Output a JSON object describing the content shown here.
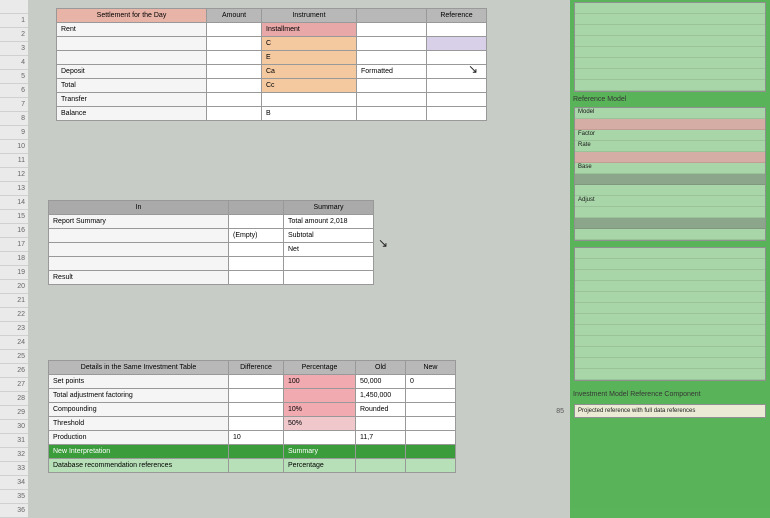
{
  "rowHeaders": [
    "",
    "1",
    "2",
    "3",
    "4",
    "5",
    "6",
    "7",
    "8",
    "9",
    "10",
    "11",
    "12",
    "13",
    "14",
    "15",
    "16",
    "17",
    "18",
    "19",
    "20",
    "21",
    "22",
    "23",
    "24",
    "25",
    "26",
    "27",
    "28",
    "29",
    "30",
    "31",
    "32",
    "33",
    "34",
    "35",
    "36"
  ],
  "t1": {
    "headers": [
      "Settlement for the Day",
      "Amount",
      "Instrument",
      "",
      "Reference"
    ],
    "rows": [
      {
        "c": [
          "Rent",
          "",
          "Installment",
          "",
          ""
        ],
        "cls3": "cell-rose"
      },
      {
        "c": [
          "",
          "",
          "C",
          "",
          ""
        ],
        "cls3": "cell-peach",
        "cls5": "cell-lav"
      },
      {
        "c": [
          "",
          "",
          "E",
          "",
          ""
        ],
        "cls3": "cell-peach"
      },
      {
        "c": [
          "Deposit",
          "",
          "Ca",
          "Formatted",
          ""
        ],
        "cls3": "cell-peach"
      },
      {
        "c": [
          "Total",
          "",
          "Cc",
          "",
          ""
        ],
        "cls3": "cell-peach"
      },
      {
        "c": [
          "Transfer",
          "",
          "",
          "",
          ""
        ]
      },
      {
        "c": [
          "Balance",
          "",
          "B",
          "",
          ""
        ]
      }
    ]
  },
  "t2": {
    "headers": [
      "In",
      "",
      "Summary"
    ],
    "rows": [
      {
        "c": [
          "Report Summary",
          "",
          "Total amount 2,018"
        ]
      },
      {
        "c": [
          "",
          "(Empty)",
          "Subtotal"
        ]
      },
      {
        "c": [
          "",
          "",
          "Net"
        ]
      },
      {
        "c": [
          "",
          "",
          ""
        ]
      },
      {
        "c": [
          "Result",
          "",
          ""
        ]
      }
    ]
  },
  "t3": {
    "headers": [
      "Details in the Same Investment Table",
      "Difference",
      "Percentage",
      "Old",
      "New"
    ],
    "rows": [
      {
        "c": [
          "Set points",
          "",
          "100",
          "50,000",
          "0"
        ],
        "cls3": "cell-pink"
      },
      {
        "c": [
          "Total adjustment factoring",
          "",
          "",
          "1,450,000",
          ""
        ],
        "cls3": "cell-pink"
      },
      {
        "c": [
          "Compounding",
          "",
          "10%",
          "Rounded",
          ""
        ],
        "cls3": "cell-pink"
      },
      {
        "c": [
          "Threshold",
          "",
          "50%",
          "",
          ""
        ],
        "cls3": "cell-blush"
      },
      {
        "c": [
          "Production",
          "10",
          "",
          "11,7",
          ""
        ]
      }
    ],
    "greenHeader": [
      "New Interpretation",
      "",
      "Summary",
      "",
      ""
    ],
    "greenRow": [
      "Database recommendation references",
      "",
      "Percentage",
      "",
      ""
    ]
  },
  "side": {
    "block1": [
      "",
      "",
      "",
      "",
      "",
      "",
      "",
      ""
    ],
    "title2": "Reference Model",
    "block2": [
      {
        "t": "Model",
        "cls": ""
      },
      {
        "t": "",
        "cls": "pink"
      },
      {
        "t": "Factor",
        "cls": ""
      },
      {
        "t": "Rate",
        "cls": ""
      },
      {
        "t": "",
        "cls": "pink"
      },
      {
        "t": "Base",
        "cls": ""
      },
      {
        "t": "",
        "cls": "dark"
      },
      {
        "t": "",
        "cls": ""
      },
      {
        "t": "Adjust",
        "cls": ""
      },
      {
        "t": "",
        "cls": ""
      },
      {
        "t": "",
        "cls": "dark"
      },
      {
        "t": "",
        "cls": ""
      }
    ],
    "block3": [
      "",
      "",
      "",
      "",
      "",
      "",
      "",
      "",
      "",
      "",
      "",
      ""
    ],
    "title4": "Investment Model Reference Component",
    "callout": "Projected reference with full data references",
    "label": "85"
  }
}
